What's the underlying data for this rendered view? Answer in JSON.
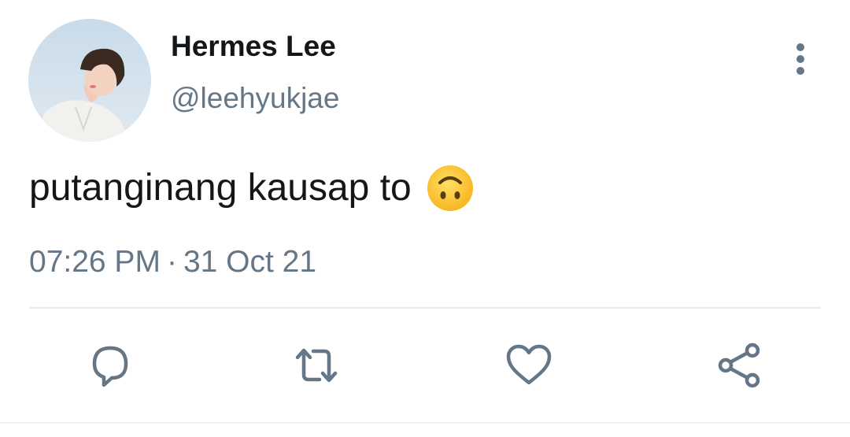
{
  "user": {
    "display_name": "Hermes Lee",
    "handle": "@leehyukjae"
  },
  "tweet": {
    "text": "putanginang kausap to",
    "emoji": "upside-down-face-emoji",
    "time": "07:26 PM",
    "separator": "·",
    "date": "31 Oct 21"
  },
  "icons": {
    "more": "more-vertical-icon",
    "reply": "reply-icon",
    "retweet": "retweet-icon",
    "like": "heart-icon",
    "share": "share-icon"
  },
  "colors": {
    "primary_text": "#14171a",
    "secondary_text": "#657786",
    "divider": "#e6ecf0",
    "emoji_yellow": "#ffcc33"
  }
}
